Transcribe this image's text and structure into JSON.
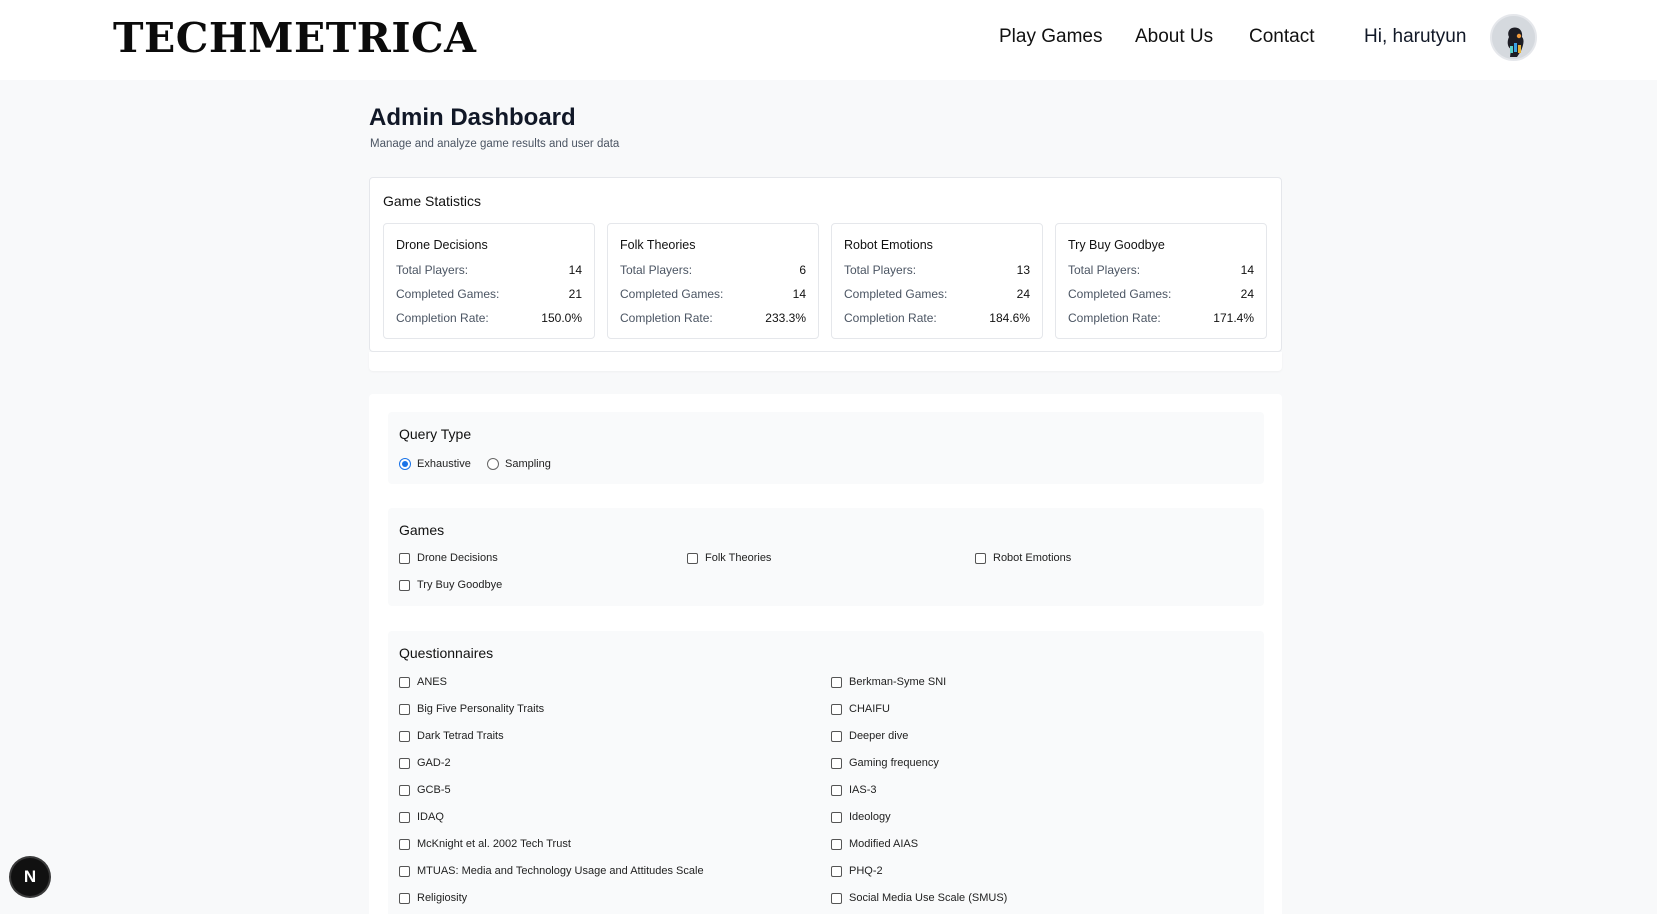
{
  "header": {
    "logo": "TECHMETRICA",
    "nav": [
      "Play Games",
      "About Us",
      "Contact"
    ],
    "greeting": "Hi, harutyun"
  },
  "page": {
    "title": "Admin Dashboard",
    "subtitle": "Manage and analyze game results and user data"
  },
  "stats": {
    "title": "Game Statistics",
    "labels": {
      "players": "Total Players:",
      "completed": "Completed Games:",
      "rate": "Completion Rate:"
    },
    "games": [
      {
        "name": "Drone Decisions",
        "players": "14",
        "completed": "21",
        "rate": "150.0%"
      },
      {
        "name": "Folk Theories",
        "players": "6",
        "completed": "14",
        "rate": "233.3%"
      },
      {
        "name": "Robot Emotions",
        "players": "13",
        "completed": "24",
        "rate": "184.6%"
      },
      {
        "name": "Try Buy Goodbye",
        "players": "14",
        "completed": "24",
        "rate": "171.4%"
      }
    ]
  },
  "query_type": {
    "title": "Query Type",
    "options": [
      "Exhaustive",
      "Sampling"
    ],
    "selected": "Exhaustive"
  },
  "games_filter": {
    "title": "Games",
    "options": [
      "Drone Decisions",
      "Folk Theories",
      "Robot Emotions",
      "Try Buy Goodbye"
    ]
  },
  "questionnaires": {
    "title": "Questionnaires",
    "left": [
      "ANES",
      "Big Five Personality Traits",
      "Dark Tetrad Traits",
      "GAD-2",
      "GCB-5",
      "IDAQ",
      "McKnight et al. 2002 Tech Trust",
      "MTUAS: Media and Technology Usage and Attitudes Scale",
      "Religiosity"
    ],
    "right": [
      "Berkman-Syme SNI",
      "CHAIFU",
      "Deeper dive",
      "Gaming frequency",
      "IAS-3",
      "Ideology",
      "Modified AIAS",
      "PHQ-2",
      "Social Media Use Scale (SMUS)"
    ]
  },
  "badge": "N"
}
